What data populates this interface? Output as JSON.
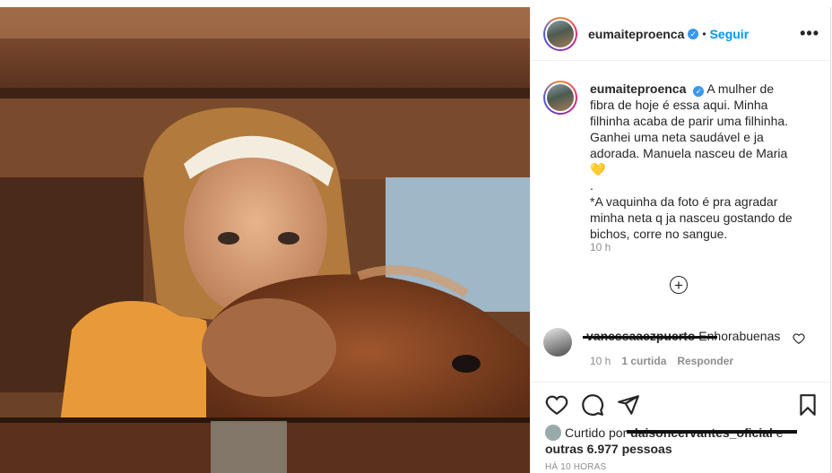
{
  "post": {
    "username": "eumaiteproenca",
    "dot": "•",
    "follow_label": "Seguir",
    "more_label": "•••",
    "caption_lines": [
      "A mulher de fibra de hoje é essa aqui. Minha filhinha acaba de parir uma filhinha. Ganhei uma neta saudável e ja adorada. Manuela nasceu de Maria💛",
      ".",
      "*A vaquinha da foto é pra agradar minha neta q ja nasceu gostando de bichos, corre no sangue."
    ],
    "caption_time": "10 h"
  },
  "comment": {
    "username": "vanessaaezpuerto",
    "text": "Enhorabuenas",
    "time": "10 h",
    "likes": "1 curtida",
    "reply_label": "Responder"
  },
  "likes_text_1": "Curtido por",
  "likes_user": "daisoncervantes_oficial",
  "likes_text_2": "e",
  "likes_text_3": "outras 6.977 pessoas",
  "time_ago": "HÁ 10 HORAS",
  "icons": [
    "verified-icon",
    "more-icon",
    "add-comment-icon",
    "heart-icon",
    "comment-icon",
    "share-icon",
    "bookmark-icon"
  ],
  "colors": {
    "accent": "#0095f6",
    "verified": "#3897f0",
    "muted": "#8e8e8e"
  }
}
